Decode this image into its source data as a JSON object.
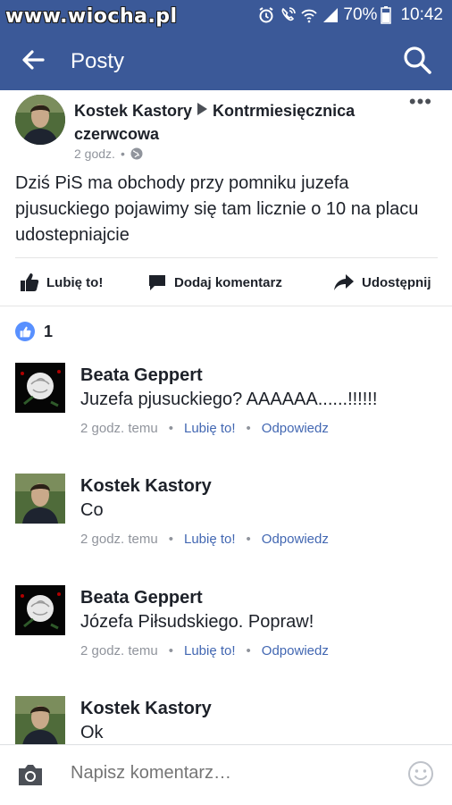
{
  "status_bar": {
    "watermark": "www.wiocha.pl",
    "battery": "70%",
    "time": "10:42"
  },
  "app_bar": {
    "title": "Posty",
    "icons": [
      "back-arrow-icon",
      "search-icon"
    ]
  },
  "post": {
    "author": "Kostek Kastory",
    "target": "Kontrmiesięcznica czerwcowa",
    "time": "2 godz.",
    "separator": "•",
    "privacy_icon": "globe-icon",
    "more": "•••",
    "body": "Dziś PiS ma obchody przy pomniku juzefa pjusuckiego pojawimy się tam licznie o 10 na placu udostepniajcie"
  },
  "actions": {
    "like": "Lubię to!",
    "comment": "Dodaj komentarz",
    "share": "Udostępnij"
  },
  "reactions": {
    "count": "1",
    "icon": "thumbs-up-icon"
  },
  "comments": [
    {
      "name": "Beata Geppert",
      "text": "Juzefa pjusuckiego? AAAAAA......!!!!!!",
      "time": "2 godz. temu",
      "like": "Lubię to!",
      "reply": "Odpowiedz",
      "avatar": "white-rose-photo"
    },
    {
      "name": "Kostek Kastory",
      "text": "Co",
      "time": "2 godz. temu",
      "like": "Lubię to!",
      "reply": "Odpowiedz",
      "avatar": "man-photo"
    },
    {
      "name": "Beata Geppert",
      "text": "Józefa Piłsudskiego. Popraw!",
      "time": "2 godz. temu",
      "like": "Lubię to!",
      "reply": "Odpowiedz",
      "avatar": "white-rose-photo"
    },
    {
      "name": "Kostek Kastory",
      "text": "Ok",
      "time": "",
      "like": "",
      "reply": "",
      "avatar": "man-photo"
    }
  ],
  "composer": {
    "placeholder": "Napisz komentarz…"
  },
  "colors": {
    "brand": "#3b5998",
    "link": "#4267b2",
    "meta": "#90949c",
    "like_badge": "#5890ff"
  }
}
